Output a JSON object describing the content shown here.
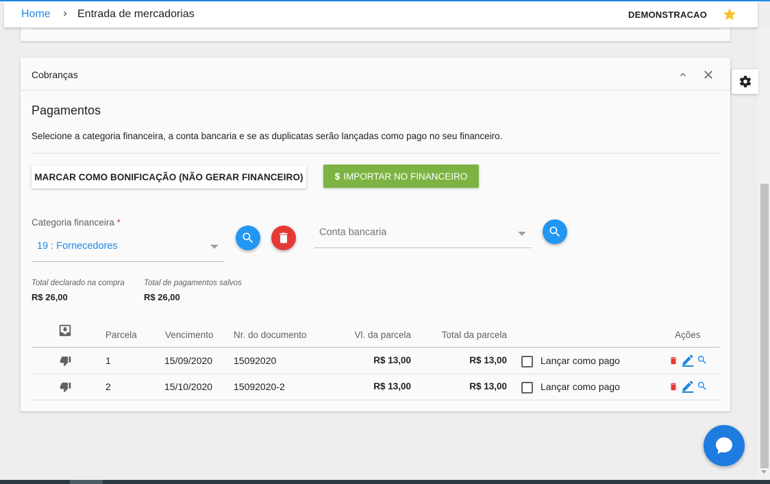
{
  "breadcrumb": {
    "home": "Home",
    "current": "Entrada de mercadorias"
  },
  "header": {
    "company": "DEMONSTRACAO"
  },
  "icons": {
    "chevron": "chevron-right-icon",
    "star": "star-icon",
    "gear": "gear-icon",
    "collapse": "chevron-up-icon",
    "close": "close-icon",
    "search": "search-icon",
    "delete": "trash-icon",
    "import": "inbox-download-icon",
    "status": "thumbs-down-icon",
    "edit": "pencil-icon",
    "chat": "chat-icon"
  },
  "colors": {
    "accent": "#1e88e5",
    "success": "#7cb342",
    "danger": "#e53935",
    "star": "#fbc02d"
  },
  "card": {
    "title": "Cobranças",
    "section_title": "Pagamentos",
    "description": "Selecione a categoria financeira, a conta bancaria e se as duplicatas serão lançadas como pago no seu financeiro."
  },
  "buttons": {
    "bonus": "MARCAR COMO BONIFICAÇÃO (NÃO GERAR FINANCEIRO)",
    "import_symbol": "$",
    "import": "IMPORTAR NO FINANCEIRO"
  },
  "form": {
    "categoria_label": "Categoria financeira",
    "categoria_required": "*",
    "categoria_value": "19 : Fornecedores",
    "conta_placeholder": "Conta bancaria"
  },
  "summary": [
    {
      "label": "Total declarado na compra",
      "value": "R$ 26,00"
    },
    {
      "label": "Total de pagamentos salvos",
      "value": "R$ 26,00"
    }
  ],
  "table": {
    "headers": {
      "parcela": "Parcela",
      "vencimento": "Vencimento",
      "documento": "Nr. do documento",
      "valor": "Vl. da parcela",
      "total": "Total da parcela",
      "acoes": "Ações"
    },
    "rows": [
      {
        "parcela": "1",
        "vencimento": "15/09/2020",
        "documento": "15092020",
        "valor": "R$ 13,00",
        "total": "R$ 13,00",
        "pago_label": "Lançar como pago",
        "pago": false
      },
      {
        "parcela": "2",
        "vencimento": "15/10/2020",
        "documento": "15092020-2",
        "valor": "R$ 13,00",
        "total": "R$ 13,00",
        "pago_label": "Lançar como pago",
        "pago": false
      }
    ]
  }
}
